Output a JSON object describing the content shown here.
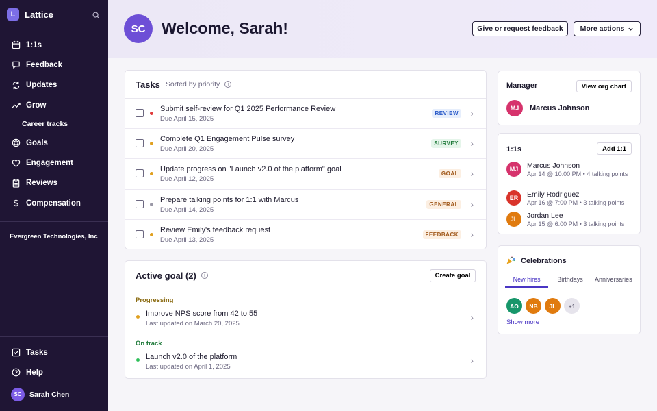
{
  "app": {
    "logo_letter": "L",
    "name": "Lattice"
  },
  "sidebar": {
    "items": [
      {
        "label": "1:1s",
        "icon": "calendar-icon"
      },
      {
        "label": "Feedback",
        "icon": "message-icon"
      },
      {
        "label": "Updates",
        "icon": "refresh-icon"
      },
      {
        "label": "Grow",
        "icon": "trending-up-icon"
      }
    ],
    "sub_item": "Career tracks",
    "items2": [
      {
        "label": "Goals",
        "icon": "target-icon"
      },
      {
        "label": "Engagement",
        "icon": "heart-icon"
      },
      {
        "label": "Reviews",
        "icon": "clipboard-icon"
      },
      {
        "label": "Compensation",
        "icon": "dollar-icon"
      }
    ],
    "org": "Evergreen Technologies, Inc",
    "bottom": {
      "tasks": "Tasks",
      "help": "Help",
      "user_initials": "SC",
      "user_name": "Sarah Chen"
    }
  },
  "header": {
    "avatar": "SC",
    "title": "Welcome, Sarah!",
    "feedback_btn": "Give or request feedback",
    "more_btn": "More actions"
  },
  "tasks": {
    "title": "Tasks",
    "subtitle": "Sorted by priority",
    "rows": [
      {
        "title": "Submit self-review for Q1 2025 Performance Review",
        "due": "Due April 15, 2025",
        "badge": "REVIEW",
        "dot": "#e03b3b",
        "badge_fg": "#2456c7",
        "badge_bg": "#e6eefc"
      },
      {
        "title": "Complete Q1 Engagement Pulse survey",
        "due": "Due April 20, 2025",
        "badge": "SURVEY",
        "dot": "#e0a020",
        "badge_fg": "#1f7a3a",
        "badge_bg": "#e5f5ea"
      },
      {
        "title": "Update progress on \"Launch v2.0 of the platform\" goal",
        "due": "Due April 12, 2025",
        "badge": "GOAL",
        "dot": "#e0a020",
        "badge_fg": "#a0581a",
        "badge_bg": "#fcefe2"
      },
      {
        "title": "Prepare talking points for 1:1 with Marcus",
        "due": "Due April 14, 2025",
        "badge": "GENERAL",
        "dot": "#9a98a6",
        "badge_fg": "#a0581a",
        "badge_bg": "#fcefe2"
      },
      {
        "title": "Review Emily's feedback request",
        "due": "Due April 13, 2025",
        "badge": "FEEDBACK",
        "dot": "#e0a020",
        "badge_fg": "#a0581a",
        "badge_bg": "#fcefe2"
      }
    ]
  },
  "goals": {
    "title": "Active goal (2)",
    "create_btn": "Create goal",
    "sections": [
      {
        "label": "Progressing",
        "color": "#8a6a10",
        "title": "Improve NPS score from 42 to 55",
        "updated": "Last updated on March 20, 2025",
        "dot": "#e0a020"
      },
      {
        "label": "On track",
        "color": "#1f7a3a",
        "title": "Launch v2.0 of the platform",
        "updated": "Last updated on April 1, 2025",
        "dot": "#2fbf5a"
      }
    ]
  },
  "manager": {
    "title": "Manager",
    "btn": "View org chart",
    "initials": "MJ",
    "name": "Marcus Johnson"
  },
  "ones": {
    "title": "1:1s",
    "btn": "Add 1:1",
    "rows": [
      {
        "initials": "MJ",
        "name": "Marcus Johnson",
        "meta": "Apr 14 @ 10:00 PM • 4 talking points",
        "color": "#d6336c"
      },
      {
        "initials": "ER",
        "name": "Emily Rodriguez",
        "meta": "Apr 16 @ 7:00 PM • 3 talking points",
        "color": "#d9342b"
      },
      {
        "initials": "JL",
        "name": "Jordan Lee",
        "meta": "Apr 15 @ 6:00 PM • 3 talking points",
        "color": "#e07b0f"
      }
    ]
  },
  "celebrations": {
    "icon": "party-popper-icon",
    "title": "Celebrations",
    "tabs": [
      "New hires",
      "Birthdays",
      "Anniversaries"
    ],
    "avatars": [
      {
        "initials": "AO",
        "color": "#17966a"
      },
      {
        "initials": "NB",
        "color": "#e07b0f"
      },
      {
        "initials": "JL",
        "color": "#e07b0f"
      }
    ],
    "more": "+1",
    "show_more": "Show more"
  }
}
